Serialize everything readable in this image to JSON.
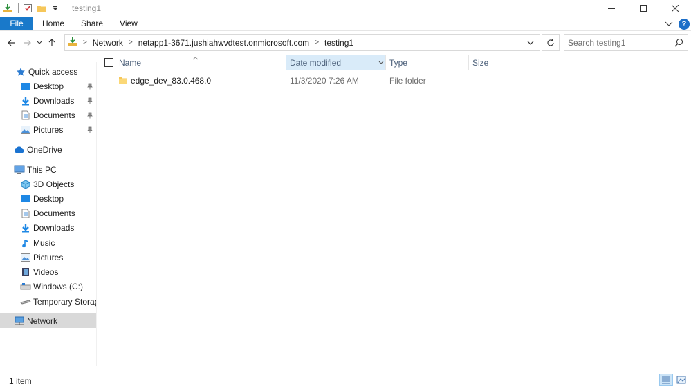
{
  "window": {
    "title": "testing1"
  },
  "ribbon": {
    "file_tab": "File",
    "tabs": [
      "Home",
      "Share",
      "View"
    ]
  },
  "address": {
    "crumbs": [
      "Network",
      "netapp1-3671.jushiahwvdtest.onmicrosoft.com",
      "testing1"
    ]
  },
  "search": {
    "placeholder": "Search testing1"
  },
  "navigation": {
    "quick_access": "Quick access",
    "quick_access_items": [
      "Desktop",
      "Downloads",
      "Documents",
      "Pictures"
    ],
    "onedrive": "OneDrive",
    "this_pc": "This PC",
    "this_pc_items": [
      "3D Objects",
      "Desktop",
      "Documents",
      "Downloads",
      "Music",
      "Pictures",
      "Videos",
      "Windows (C:)",
      "Temporary Storage"
    ],
    "network": "Network"
  },
  "columns": {
    "name": "Name",
    "date_modified": "Date modified",
    "type": "Type",
    "size": "Size"
  },
  "files": [
    {
      "name": "edge_dev_83.0.468.0",
      "date_modified": "11/3/2020 7:26 AM",
      "type": "File folder",
      "size": ""
    }
  ],
  "status": {
    "item_count": "1 item"
  },
  "colors": {
    "file_tab": "#1979ca",
    "sorted_header": "#d9ebf9",
    "selected_nav": "#d9d9d9",
    "folder": "#f6c75a"
  }
}
